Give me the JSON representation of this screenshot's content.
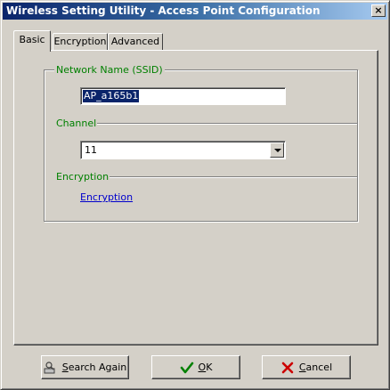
{
  "window": {
    "title": "Wireless Setting Utility - Access Point Configuration",
    "close_glyph": "×"
  },
  "tabs": [
    {
      "label": "Basic",
      "active": true
    },
    {
      "label": "Encryption",
      "active": false
    },
    {
      "label": "Advanced",
      "active": false
    }
  ],
  "basic": {
    "ssid_label": "Network Name (SSID)",
    "ssid_value": "AP_a165b1",
    "channel_label": "Channel",
    "channel_value": "11",
    "encryption_label": "Encryption",
    "encryption_link": "Encryption"
  },
  "buttons": {
    "search_again": "Search Again",
    "ok": "OK",
    "cancel": "Cancel"
  },
  "icons": {
    "search_again": "search-again-icon",
    "ok": "checkmark-icon",
    "cancel": "x-icon"
  },
  "colors": {
    "section_label": "#008000",
    "link": "#0000cc",
    "selection": "#0a246a",
    "ok_icon": "#008000",
    "cancel_icon": "#cc0000"
  }
}
